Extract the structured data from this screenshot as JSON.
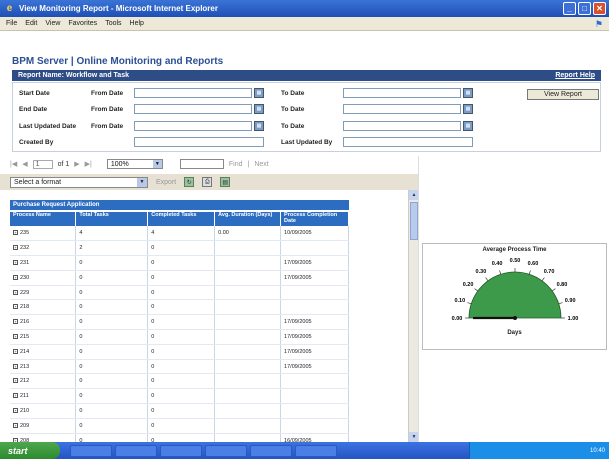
{
  "window": {
    "title": "View Monitoring Report - Microsoft Internet Explorer",
    "minimize": "_",
    "maximize": "□",
    "close": "✕"
  },
  "menu": [
    "File",
    "Edit",
    "View",
    "Favorites",
    "Tools",
    "Help"
  ],
  "app_title": "BPM Server | Online Monitoring and Reports",
  "report_bar": {
    "name": "Report Name: Workflow and Task",
    "help": "Report Help"
  },
  "filters": {
    "start_date": "Start Date",
    "end_date": "End Date",
    "last_updated_date": "Last Updated Date",
    "created_by": "Created By",
    "from_date": "From Date",
    "to_date": "To Date",
    "last_updated_by": "Last Updated By",
    "view_report": "View Report"
  },
  "viewer_toolbar": {
    "first": "|◀",
    "prev": "◀",
    "page": "1",
    "of": "of 1",
    "next": "▶",
    "last": "▶|",
    "zoom": "100%",
    "find": "Find",
    "sep": "|",
    "next_label": "Next",
    "format_placeholder": "Select a format",
    "export": "Export"
  },
  "table": {
    "title": "Purchase Request Application",
    "headers": [
      "Process Name",
      "Total Tasks",
      "Completed Tasks",
      "Avg. Duration (Days)",
      "Process Completion Date"
    ],
    "rows": [
      [
        "235",
        "4",
        "4",
        "0.00",
        "10/09/2005"
      ],
      [
        "232",
        "2",
        "0",
        "",
        ""
      ],
      [
        "231",
        "0",
        "0",
        "",
        "17/09/2005"
      ],
      [
        "230",
        "0",
        "0",
        "",
        "17/09/2005"
      ],
      [
        "229",
        "0",
        "0",
        "",
        ""
      ],
      [
        "218",
        "0",
        "0",
        "",
        ""
      ],
      [
        "216",
        "0",
        "0",
        "",
        "17/09/2005"
      ],
      [
        "215",
        "0",
        "0",
        "",
        "17/09/2005"
      ],
      [
        "214",
        "0",
        "0",
        "",
        "17/09/2005"
      ],
      [
        "213",
        "0",
        "0",
        "",
        "17/09/2005"
      ],
      [
        "212",
        "0",
        "0",
        "",
        ""
      ],
      [
        "211",
        "0",
        "0",
        "",
        ""
      ],
      [
        "210",
        "0",
        "0",
        "",
        ""
      ],
      [
        "209",
        "0",
        "0",
        "",
        ""
      ],
      [
        "208",
        "0",
        "0",
        "",
        "16/09/2005"
      ]
    ]
  },
  "gauge": {
    "title": "Average Process Time",
    "axis_label": "Days",
    "ticks": [
      "0.00",
      "0.10",
      "0.20",
      "0.30",
      "0.40",
      "0.50",
      "0.60",
      "0.70",
      "0.80",
      "0.90",
      "1.00"
    ],
    "value": 0,
    "fill_color": "#3c9a4a"
  },
  "taskbar": {
    "start": "start",
    "time": "10:40"
  }
}
